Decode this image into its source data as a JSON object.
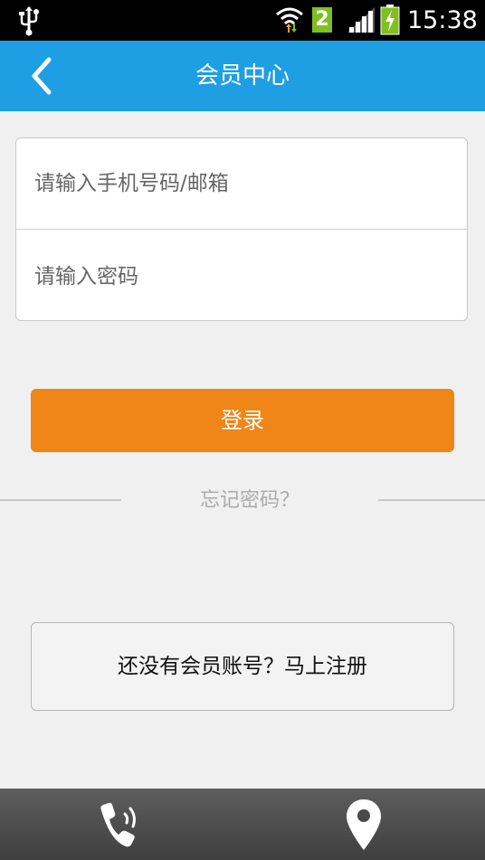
{
  "status_bar": {
    "time": "15:38",
    "sim_slot": "2",
    "icons": [
      "usb-icon",
      "wifi-icon",
      "signal-icon",
      "battery-icon"
    ]
  },
  "header": {
    "title": "会员中心",
    "back_icon": "chevron-left-icon"
  },
  "form": {
    "phone_placeholder": "请输入手机号码/邮箱",
    "password_placeholder": "请输入密码"
  },
  "login_button": "登录",
  "forgot_password": "忘记密码？",
  "register_button": "还没有会员账号？马上注册",
  "bottom_bar": {
    "icons": [
      "phone-icon",
      "location-pin-icon"
    ]
  },
  "colors": {
    "header": "#1e9fe3",
    "login_button": "#f08518",
    "background": "#f0f0f0"
  }
}
